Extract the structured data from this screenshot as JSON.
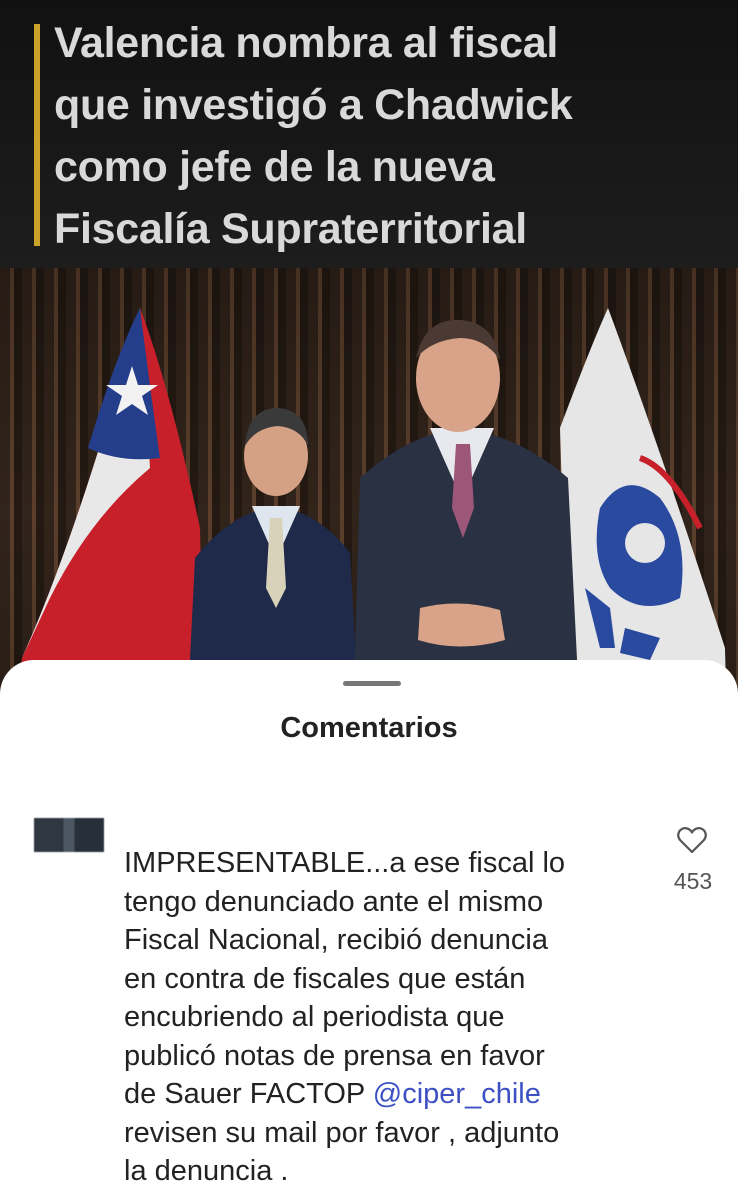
{
  "post": {
    "headline_lines": [
      "Valencia nombra al fiscal",
      "que investigó a Chadwick",
      "como jefe de la nueva",
      "Fiscalía Supraterritorial"
    ]
  },
  "sheet": {
    "title": "Comentarios"
  },
  "comment": {
    "text_lines": [
      "IMPRESENTABLE...a ese fiscal lo",
      "tengo denunciado ante el mismo",
      "Fiscal Nacional, recibió denuncia",
      "en contra de fiscales que están",
      "encubriendo al periodista que",
      "publicó notas de prensa en favor",
      "de Sauer FACTOP ",
      "revisen su mail por favor , adjunto",
      "la denuncia ."
    ],
    "mention": "@ciper_chile",
    "likes": "453"
  },
  "colors": {
    "headline_accent": "#c9a227",
    "mention": "#3d51c4",
    "flag_red": "#c8202a",
    "flag_blue": "#243e8c"
  },
  "icons": {
    "like": "heart-outline-icon"
  }
}
